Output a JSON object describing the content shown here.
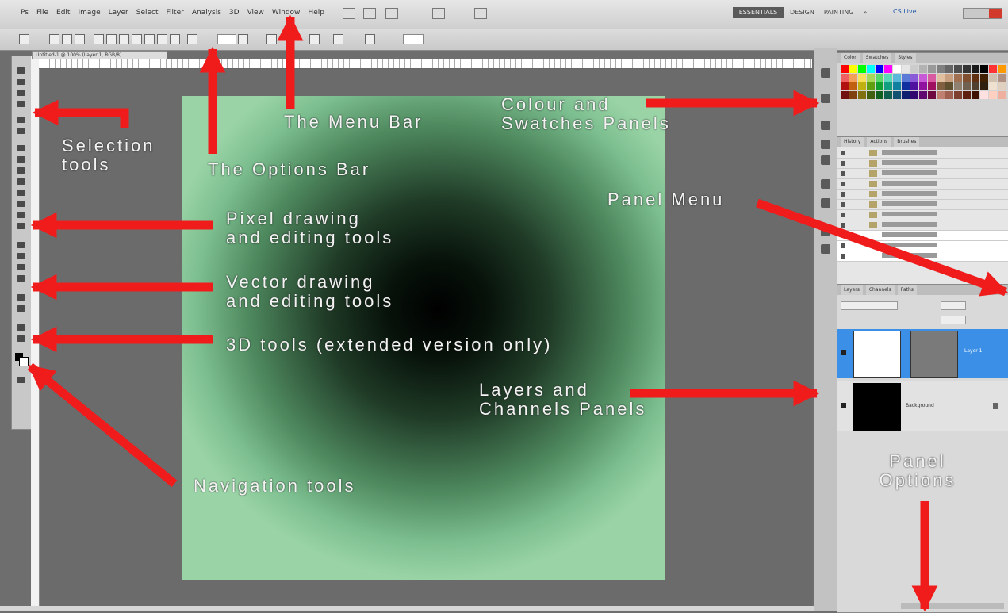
{
  "menubar": {
    "items": [
      "Ps",
      "File",
      "Edit",
      "Image",
      "Layer",
      "Select",
      "Filter",
      "Analysis",
      "3D",
      "View",
      "Window",
      "Help"
    ],
    "workspace_button": "ESSENTIALS",
    "workspace_links": [
      "DESIGN",
      "PAINTING",
      "»"
    ],
    "cs_live": "CS Live"
  },
  "document": {
    "tab_label": "Untitled-1 @ 100% (Layer 1, RGB/8)"
  },
  "swatches": {
    "tabs": [
      "Color",
      "Swatches",
      "Styles"
    ],
    "colors": [
      "#ff0000",
      "#ffff00",
      "#00ff00",
      "#00ffff",
      "#0000ff",
      "#ff00ff",
      "#ffffff",
      "#e6e6e6",
      "#cccccc",
      "#b3b3b3",
      "#999999",
      "#808080",
      "#666666",
      "#4d4d4d",
      "#333333",
      "#1a1a1a",
      "#000000",
      "#ff3333",
      "#ff9900",
      "#f06060",
      "#f2a05a",
      "#f7e05a",
      "#a8d85a",
      "#5ad86a",
      "#5ad8b8",
      "#5ab8d8",
      "#5a7ad8",
      "#8a5ad8",
      "#c85ad8",
      "#d85aa0",
      "#e0c0a0",
      "#c8a080",
      "#a07050",
      "#805030",
      "#603010",
      "#402000",
      "#d0c0b0",
      "#b09080",
      "#b01010",
      "#c06010",
      "#c0b010",
      "#60a010",
      "#10a030",
      "#10a080",
      "#1080a0",
      "#1030a0",
      "#5010a0",
      "#9010a0",
      "#a01060",
      "#806040",
      "#605030",
      "#908070",
      "#706050",
      "#504030",
      "#302010",
      "#f0e0d0",
      "#e0d0c0",
      "#701010",
      "#804010",
      "#807010",
      "#406010",
      "#106020",
      "#106050",
      "#105070",
      "#102070",
      "#300870",
      "#600870",
      "#700840",
      "#c08070",
      "#a06050",
      "#804030",
      "#602010",
      "#401000",
      "#ffe0e0",
      "#ffd0c0",
      "#f0b0a0"
    ]
  },
  "history": {
    "tabs": [
      "History",
      "Actions",
      "Brushes"
    ]
  },
  "layers": {
    "tabs": [
      "Layers",
      "Channels",
      "Paths"
    ],
    "layer1_name": "Layer 1",
    "layer0_name": "Background"
  },
  "annotations": {
    "selection_tools": [
      "Selection",
      "tools"
    ],
    "options_bar": "The Options Bar",
    "menu_bar": "The Menu Bar",
    "colour_swatches": [
      "Colour and",
      "Swatches Panels"
    ],
    "panel_menu": "Panel Menu",
    "pixel_tools": [
      "Pixel drawing",
      "and editing tools"
    ],
    "vector_tools": [
      "Vector drawing",
      "and editing tools"
    ],
    "tools_3d": "3D tools (extended version only)",
    "layers_channels": [
      "Layers and",
      "Channels Panels"
    ],
    "panel_options": [
      "Panel",
      "Options"
    ],
    "navigation_tools": "Navigation tools"
  }
}
